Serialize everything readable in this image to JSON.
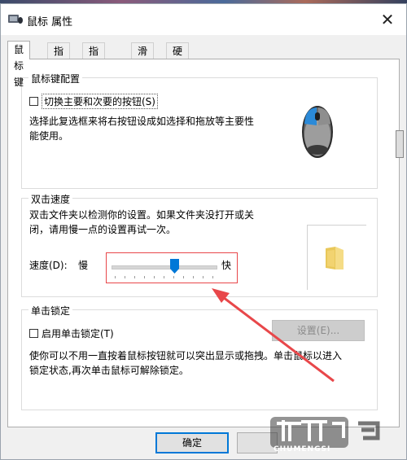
{
  "window": {
    "title": "鼠标 属性",
    "close_glyph": "✕"
  },
  "tabs": [
    {
      "label": "鼠标键"
    },
    {
      "label": "指针"
    },
    {
      "label": "指针选项"
    },
    {
      "label": "滑轮"
    },
    {
      "label": "硬件"
    }
  ],
  "button_config": {
    "group_title": "鼠标键配置",
    "switch_label": "切换主要和次要的按钮(S)",
    "switch_checked": false,
    "description": "选择此复选框来将右按钮设成如选择和拖放等主要性能使用。",
    "description_line1": "选择此复选框来将右按钮设成如选择和拖放等主要性",
    "description_line2": "能使用。"
  },
  "double_click": {
    "group_title": "双击速度",
    "description_line1": "双击文件夹以检测你的设置。如果文件夹没打开或关",
    "description_line2": "闭，请用慢一点的设置再试一次。",
    "speed_label": "速度(D):",
    "slow_label": "慢",
    "fast_label": "快",
    "speed_value": 0.6
  },
  "click_lock": {
    "group_title": "单击锁定",
    "enable_label": "启用单击锁定(T)",
    "enable_checked": false,
    "settings_label": "设置(E)...",
    "description_line1": "使你可以不用一直按着鼠标按钮就可以突出显示或拖拽。单击鼠标以进入",
    "description_line2": "锁定状态,再次单击鼠标可解除锁定。"
  },
  "footer": {
    "ok_label": "确定"
  },
  "watermark": {
    "text": "CHUMENGSI"
  },
  "colors": {
    "accent": "#0078d7",
    "annotation": "#e8474a"
  }
}
